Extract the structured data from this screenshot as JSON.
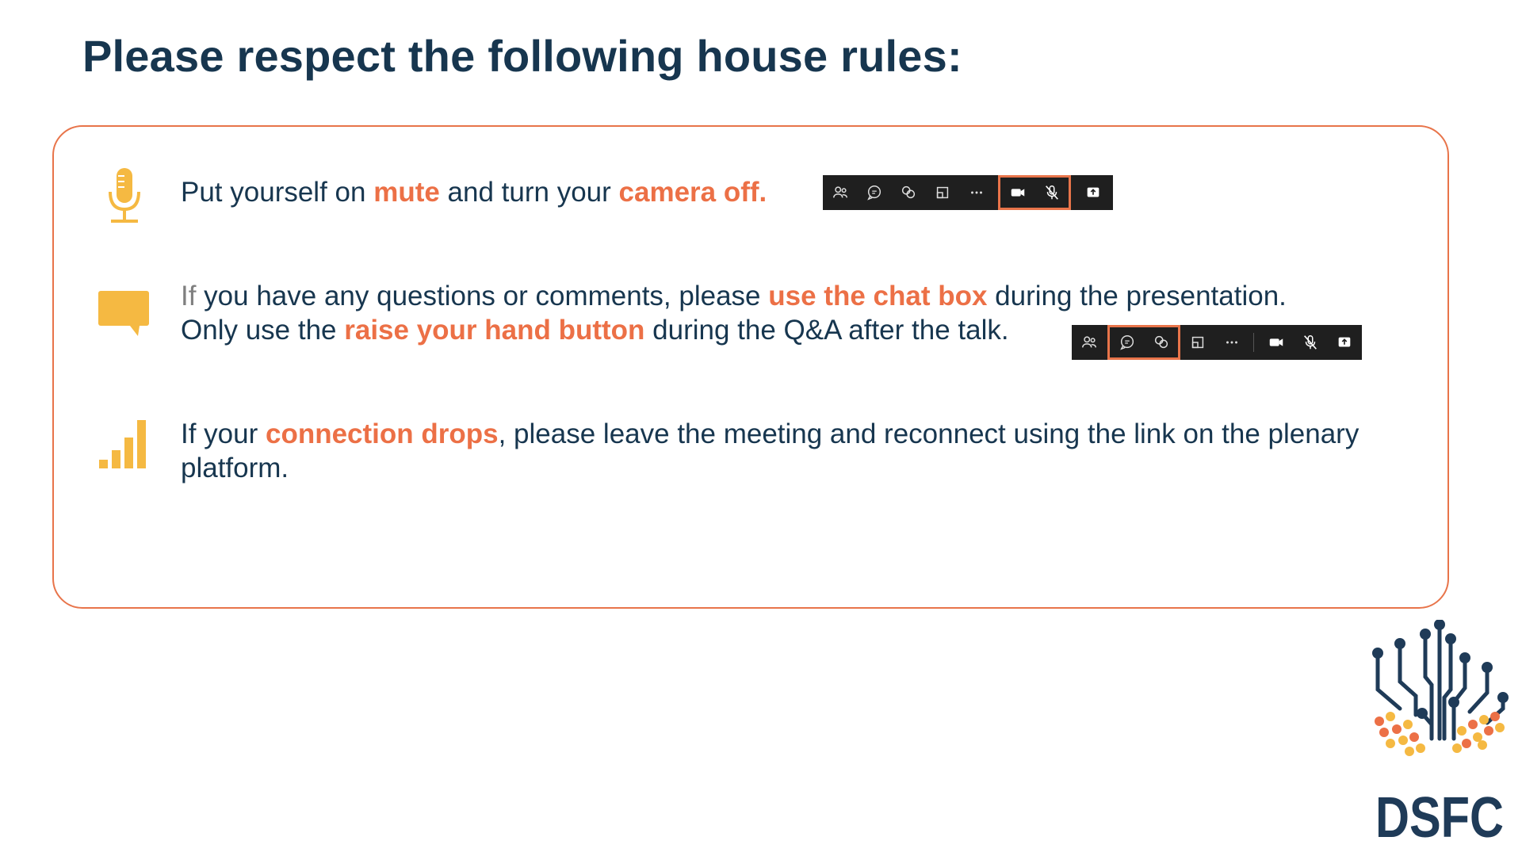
{
  "title": "Please respect the following house rules:",
  "rules": [
    {
      "icon": "microphone-icon",
      "line1": [
        "Put yourself on ",
        "mute",
        " and turn your ",
        "camera off."
      ]
    },
    {
      "icon": "chat-bubble-icon",
      "line1_prefix": "If",
      "line1": [
        " you have any questions or comments, please ",
        "use the chat box",
        " during the presentation."
      ],
      "line2": [
        "Only use the ",
        "raise your hand button",
        " during the Q&A after the talk."
      ]
    },
    {
      "icon": "signal-bars-icon",
      "line1": [
        "If your ",
        "connection drops",
        ", please leave the meeting and reconnect using the link on the plenary"
      ],
      "line2": [
        "platform."
      ]
    }
  ],
  "toolbar_icons": [
    "people-icon",
    "chat-icon",
    "raise-hand-icon",
    "rooms-icon",
    "more-icon",
    "camera-icon",
    "mic-off-icon",
    "share-icon"
  ],
  "logo": {
    "text": "DSFC"
  },
  "colors": {
    "accent": "#ec7046",
    "icon": "#f5b942",
    "text": "#17364f",
    "toolbar": "#1f1f1f"
  }
}
